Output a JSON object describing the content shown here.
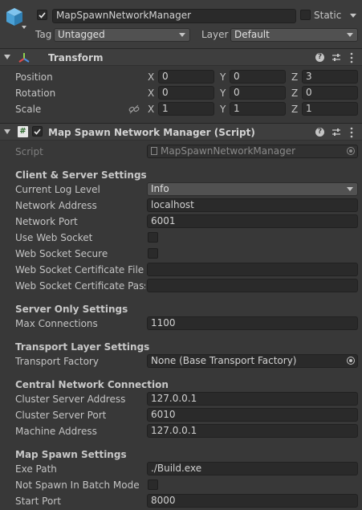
{
  "gameobject": {
    "name": "MapSpawnNetworkManager",
    "static_label": "Static",
    "tag_label": "Tag",
    "tag_value": "Untagged",
    "layer_label": "Layer",
    "layer_value": "Default",
    "active": true
  },
  "transform": {
    "title": "Transform",
    "position_label": "Position",
    "rotation_label": "Rotation",
    "scale_label": "Scale",
    "axis_x": "X",
    "axis_y": "Y",
    "axis_z": "Z",
    "position": {
      "x": "0",
      "y": "0",
      "z": "3"
    },
    "rotation": {
      "x": "0",
      "y": "0",
      "z": "0"
    },
    "scale": {
      "x": "1",
      "y": "1",
      "z": "1"
    }
  },
  "script_component": {
    "title": "Map Spawn Network Manager (Script)",
    "enabled": true,
    "script_label": "Script",
    "script_value": "MapSpawnNetworkManager",
    "client_server_title": "Client & Server Settings",
    "log_level_label": "Current Log Level",
    "log_level_value": "Info",
    "network_address_label": "Network Address",
    "network_address_value": "localhost",
    "network_port_label": "Network Port",
    "network_port_value": "6001",
    "use_web_socket_label": "Use Web Socket",
    "web_socket_secure_label": "Web Socket Secure",
    "cert_file_label": "Web Socket Certificate File P",
    "cert_pass_label": "Web Socket Certificate Passv",
    "server_only_title": "Server Only Settings",
    "max_connections_label": "Max Connections",
    "max_connections_value": "1100",
    "transport_title": "Transport Layer Settings",
    "transport_factory_label": "Transport Factory",
    "transport_factory_value": "None (Base Transport Factory)",
    "central_title": "Central Network Connection",
    "cluster_address_label": "Cluster Server Address",
    "cluster_address_value": "127.0.0.1",
    "cluster_port_label": "Cluster Server Port",
    "cluster_port_value": "6010",
    "machine_address_label": "Machine Address",
    "machine_address_value": "127.0.0.1",
    "map_spawn_title": "Map Spawn Settings",
    "exe_path_label": "Exe Path",
    "exe_path_value": "./Build.exe",
    "not_spawn_batch_label": "Not Spawn In Batch Mode",
    "start_port_label": "Start Port",
    "start_port_value": "8000"
  },
  "icons": {
    "help": "help-icon",
    "presets": "presets-icon",
    "menu": "kebab-menu-icon",
    "foldout": "foldout-triangle-icon"
  },
  "colors": {
    "background": "#383838",
    "header": "#3e3e3e",
    "field": "#2a2a2a",
    "text": "#c4c4c4"
  }
}
